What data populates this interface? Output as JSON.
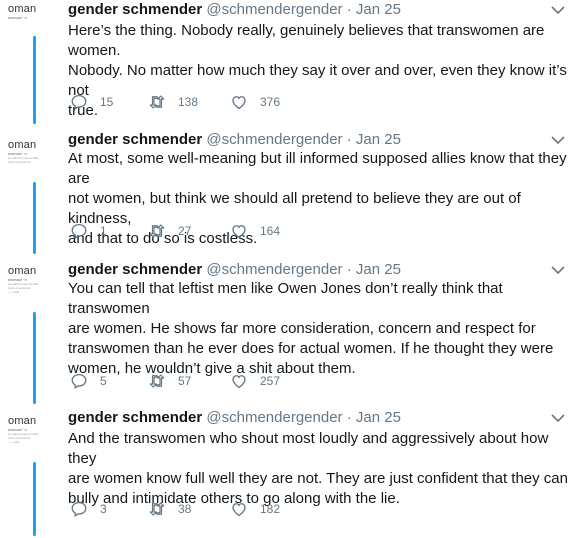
{
  "avatar": {
    "big_text": "oman",
    "line2": "woman/ ·n",
    "line3": "an adult human female",
    "line4": "(only of persons) ",
    "line5": "~~~ kids"
  },
  "tweets": [
    {
      "name": "gender schmender",
      "handle": "@schmendergender",
      "dot": "·",
      "date": "Jan 25",
      "lines": [
        "Here’s the thing. Nobody really, genuinely believes that transwomen are women.",
        "Nobody. No matter how much they say it over and over, even they know it’s not",
        "true."
      ],
      "replies": "15",
      "retweets": "138",
      "likes": "376"
    },
    {
      "name": "gender schmender",
      "handle": "@schmendergender",
      "dot": "·",
      "date": "Jan 25",
      "lines": [
        "At most, some well-meaning but ill informed supposed allies know that they are",
        "not women, but think we should all pretend to believe they are out of kindness,",
        "and that to do so is costless."
      ],
      "replies": "1",
      "retweets": "27",
      "likes": "164"
    },
    {
      "name": "gender schmender",
      "handle": "@schmendergender",
      "dot": "·",
      "date": "Jan 25",
      "lines": [
        "You can tell that leftist men like Owen Jones don’t really think that transwomen",
        "are women. He shows far more consideration, concern and respect for",
        "transwomen than he ever does for actual women. If he thought they were",
        "women, he wouldn’t give a shit about them."
      ],
      "replies": "5",
      "retweets": "57",
      "likes": "257"
    },
    {
      "name": "gender schmender",
      "handle": "@schmendergender",
      "dot": "·",
      "date": "Jan 25",
      "lines": [
        "And the transwomen who shout most loudly and aggressively about how they",
        "are women know full well they are not. They are just confident that they can",
        "bully and intimidate others to go along with the lie."
      ],
      "replies": "3",
      "retweets": "38",
      "likes": "182"
    }
  ],
  "colors": {
    "thread": "#1da1f2",
    "muted": "#657786",
    "text": "#14171a"
  },
  "icons": [
    "reply-icon",
    "retweet-icon",
    "like-icon",
    "chevron-down-icon"
  ]
}
